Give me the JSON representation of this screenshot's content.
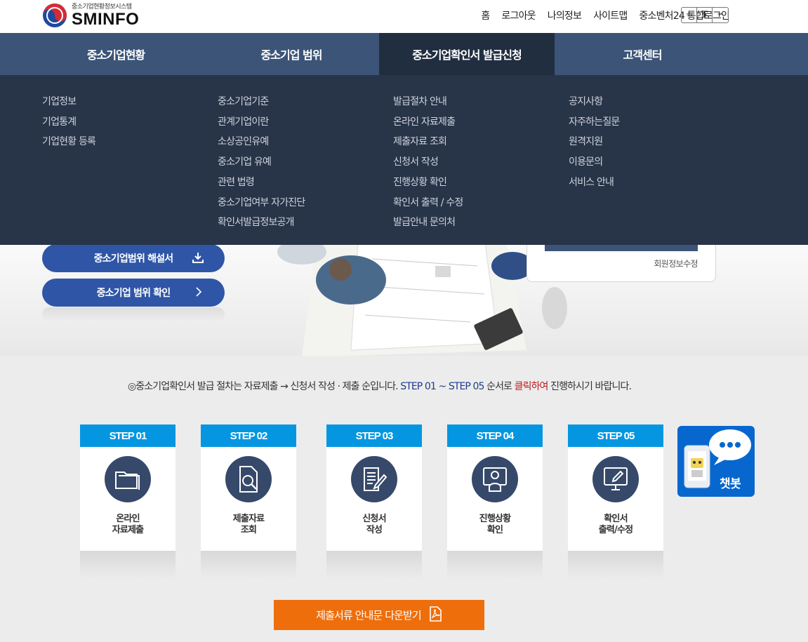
{
  "header": {
    "logo_sub": "중소기업현황정보시스템",
    "logo_main": "SMINFO",
    "util_links": [
      "홈",
      "로그아웃",
      "나의정보",
      "사이트맵",
      "중소벤처24 통합로그인"
    ],
    "font_controls": [
      "+",
      "T",
      "−"
    ]
  },
  "gnb": {
    "items": [
      "중소기업현황",
      "중소기업 범위",
      "중소기업확인서 발급신청",
      "고객센터"
    ],
    "active_index": 2
  },
  "dropdown": {
    "columns": [
      [
        "기업정보",
        "기업통계",
        "기업현황 등록"
      ],
      [
        "중소기업기준",
        "관계기업이란",
        "소상공인유예",
        "중소기업 유예",
        "관련 법령",
        "중소기업여부 자가진단",
        "확인서발급정보공개"
      ],
      [
        "발급절차 안내",
        "온라인 자료제출",
        "제출자료 조회",
        "신청서 작성",
        "진행상황 확인",
        "확인서 출력 / 수정",
        "발급안내 문의처"
      ],
      [
        "공지사항",
        "자주하는질문",
        "원격지원",
        "이용문의",
        "서비스 안내"
      ]
    ]
  },
  "hero": {
    "button1": "중소기업범위 해설서",
    "button2": "중소기업 범위 확인",
    "member_edit": "회원정보수정"
  },
  "notice": {
    "part1": "◎중소기업확인서 발급 절차는 자료제출 → 신청서 작성 · 제출 순입니다.",
    "part2": "STEP 01 ~ STEP 05",
    "part3": "순서로",
    "part4": "클릭하여",
    "part5": "진행하시기 바랍니다."
  },
  "steps": [
    {
      "head": "STEP 01",
      "label": "온라인\n자료제출",
      "icon": "folder-icon"
    },
    {
      "head": "STEP 02",
      "label": "제출자료\n조회",
      "icon": "document-search-icon"
    },
    {
      "head": "STEP 03",
      "label": "신청서\n작성",
      "icon": "document-write-icon"
    },
    {
      "head": "STEP 04",
      "label": "진행상황\n확인",
      "icon": "monitor-user-icon"
    },
    {
      "head": "STEP 05",
      "label": "확인서\n출력/수정",
      "icon": "monitor-edit-icon"
    }
  ],
  "chatbot": {
    "label": "챗봇"
  },
  "download": {
    "label": "제출서류 안내문 다운받기"
  },
  "colors": {
    "gnb": "#3c5477",
    "dropdown": "#283448",
    "step_head": "#0596e2",
    "download": "#ee6e0c",
    "chatbot": "#0767cf"
  }
}
